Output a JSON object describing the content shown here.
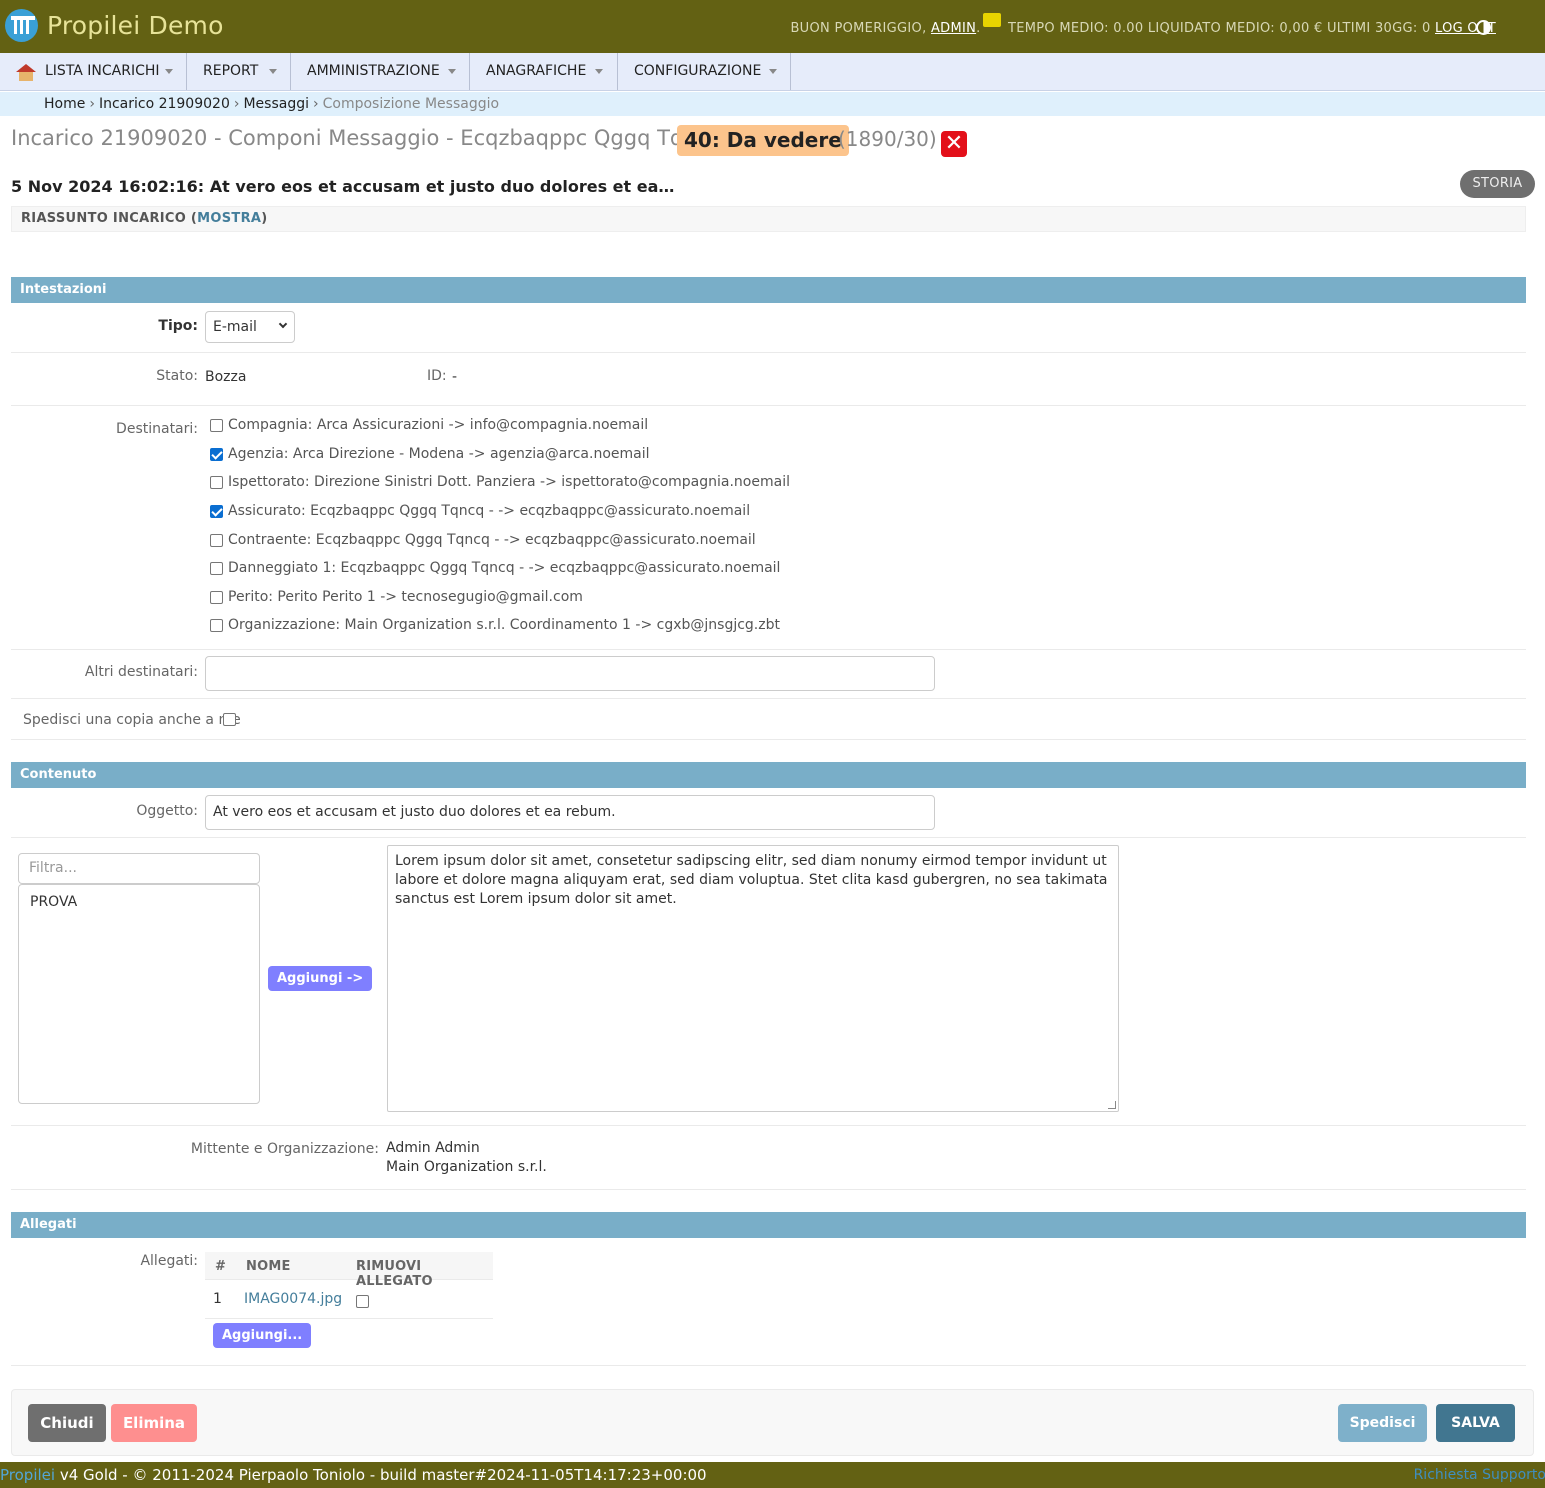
{
  "header": {
    "app_title": "Propilei Demo",
    "greeting": "BUON POMERIGGIO, ",
    "username": "ADMIN",
    "after_user": ".",
    "stats": " TEMPO MEDIO: 0.00 LIQUIDATO MEDIO: 0,00 € ULTIMI 30GG: 0 ",
    "logout": "LOG OUT",
    "colors": {
      "topbar": "#636113",
      "accent": "#79aec8"
    }
  },
  "nav": {
    "items": [
      {
        "label": "LISTA INCARICHI"
      },
      {
        "label": "REPORT"
      },
      {
        "label": "AMMINISTRAZIONE"
      },
      {
        "label": "ANAGRAFICHE"
      },
      {
        "label": "CONFIGURAZIONE"
      }
    ]
  },
  "breadcrumb": {
    "home": "Home",
    "incarico": "Incarico 21909020",
    "messaggi": "Messaggi",
    "current": "Composizione Messaggio"
  },
  "title": {
    "text": "Incarico 21909020 - Componi Messaggio - Ecqzbaqppc Qggq Tqncq",
    "status": "40: Da vedere",
    "counter": "(1890/30)"
  },
  "message": {
    "date_subject": "5 Nov 2024 16:02:16: At vero eos et accusam et justo duo dolores et ea…",
    "storia": "STORIA"
  },
  "summary": {
    "prefix": "RIASSUNTO INCARICO (",
    "link": "MOSTRA",
    "suffix": ")"
  },
  "intestazioni": {
    "heading": "Intestazioni",
    "tipo_label": "Tipo:",
    "tipo_value": "E-mail",
    "stato_label": "Stato:",
    "stato_value": "Bozza",
    "id_label": "ID:",
    "id_value": "-",
    "destinatari_label": "Destinatari:",
    "destinatari": [
      {
        "label": "Compagnia: Arca Assicurazioni -> info@compagnia.noemail",
        "checked": false
      },
      {
        "label": "Agenzia: Arca Direzione - Modena -> agenzia@arca.noemail",
        "checked": true
      },
      {
        "label": "Ispettorato: Direzione Sinistri Dott. Panziera -> ispettorato@compagnia.noemail",
        "checked": false
      },
      {
        "label": "Assicurato: Ecqzbaqppc Qggq Tqncq - -> ecqzbaqppc@assicurato.noemail",
        "checked": true
      },
      {
        "label": "Contraente: Ecqzbaqppc Qggq Tqncq - -> ecqzbaqppc@assicurato.noemail",
        "checked": false
      },
      {
        "label": "Danneggiato 1: Ecqzbaqppc Qggq Tqncq - -> ecqzbaqppc@assicurato.noemail",
        "checked": false
      },
      {
        "label": "Perito: Perito Perito 1 -> tecnosegugio@gmail.com",
        "checked": false
      },
      {
        "label": "Organizzazione: Main Organization s.r.l. Coordinamento 1 -> cgxb@jnsgjcg.zbt",
        "checked": false
      }
    ],
    "altri_label": "Altri destinatari:",
    "altri_value": "",
    "copia_label": "Spedisci una copia anche a me",
    "copia_checked": false
  },
  "contenuto": {
    "heading": "Contenuto",
    "oggetto_label": "Oggetto:",
    "oggetto_value": "At vero eos et accusam et justo duo dolores et ea rebum.",
    "filter_placeholder": "Filtra...",
    "templates": [
      "PROVA"
    ],
    "add_button": "Aggiungi ->",
    "body": "Lorem ipsum dolor sit amet, consetetur sadipscing elitr, sed diam nonumy eirmod tempor invidunt ut labore et dolore magna aliquyam erat, sed diam voluptua. Stet clita kasd gubergren, no sea takimata sanctus est Lorem ipsum dolor sit amet.",
    "mittente_label": "Mittente e Organizzazione:",
    "mittente_name": "Admin Admin",
    "mittente_org": "Main Organization s.r.l."
  },
  "allegati": {
    "heading": "Allegati",
    "label": "Allegati:",
    "columns": [
      "#",
      "NOME",
      "RIMUOVI ALLEGATO"
    ],
    "rows": [
      {
        "num": "1",
        "name": "IMAG0074.jpg",
        "remove": false
      }
    ],
    "add_button": "Aggiungi..."
  },
  "actions": {
    "chiudi": "Chiudi",
    "elimina": "Elimina",
    "spedisci": "Spedisci",
    "salva": "SALVA"
  },
  "footer": {
    "brand": "Propilei",
    "text": " v4 Gold - © 2011-2024 Pierpaolo Toniolo - build master#2024-11-05T14:17:23+00:00",
    "support": "Richiesta Supporto"
  }
}
